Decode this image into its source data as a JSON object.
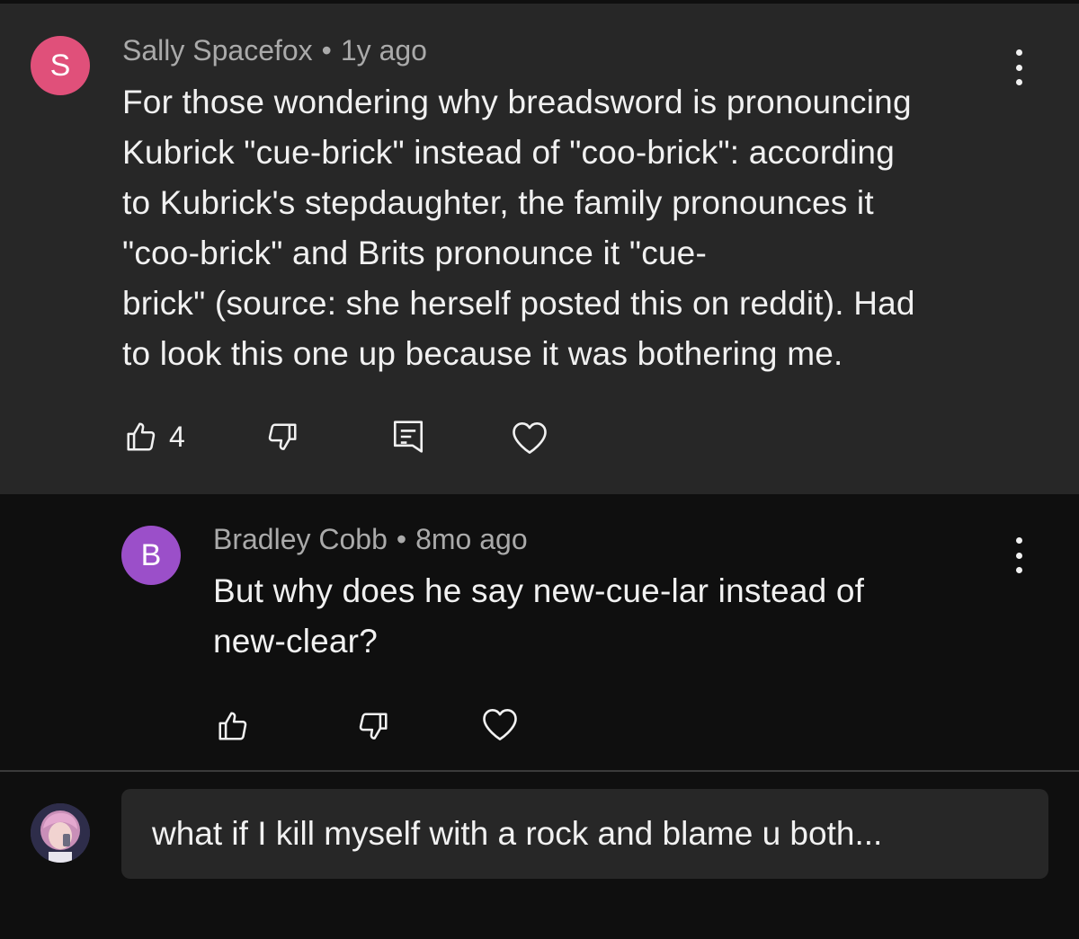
{
  "comment": {
    "avatar_letter": "S",
    "avatar_color": "#e0507a",
    "author": "Sally Spacefox",
    "separator": "•",
    "time": "1y ago",
    "lines": [
      "For those wondering why breadsword is pronouncing",
      "Kubrick \"cue-brick\" instead of \"coo-brick\": according",
      "to Kubrick's stepdaughter, the family pronounces it",
      "\"coo-brick\" and Brits pronounce it \"cue-",
      "brick\" (source: she herself posted this on reddit). Had",
      "to look this one up because it was bothering me."
    ],
    "like_count": "4",
    "icons": [
      "thumbs-up-icon",
      "thumbs-down-icon",
      "reply-icon",
      "heart-icon",
      "more-vert-icon"
    ]
  },
  "reply": {
    "avatar_letter": "B",
    "avatar_color": "#9b4fc9",
    "author": "Bradley Cobb",
    "separator": "•",
    "time": "8mo ago",
    "lines": [
      "But why does he say new-cue-lar instead of",
      "new-clear?"
    ],
    "icons": [
      "thumbs-up-icon",
      "thumbs-down-icon",
      "heart-icon",
      "more-vert-icon"
    ]
  },
  "composer": {
    "value": "what if I kill myself with a rock and blame u both..."
  },
  "colors": {
    "background": "#0f0f0f",
    "card": "#272727",
    "text": "#f1f1f1",
    "meta": "#aaaaaa"
  }
}
